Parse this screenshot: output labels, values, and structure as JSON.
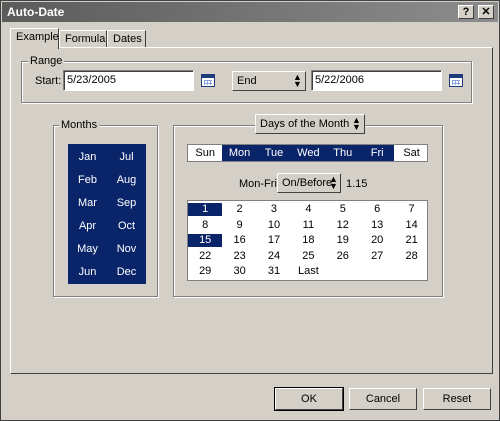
{
  "window": {
    "title": "Auto-Date",
    "help_button": "?",
    "close_button": "✕"
  },
  "tabs": [
    {
      "label": "Example",
      "active": true
    },
    {
      "label": "Formula",
      "active": false
    },
    {
      "label": "Dates",
      "active": false
    }
  ],
  "range": {
    "group_label": "Range",
    "start_label": "Start:",
    "start_value": "5/23/2005",
    "mode_select": "End",
    "end_value": "5/22/2006"
  },
  "months": {
    "group_label": "Months",
    "items": [
      "Jan",
      "Jul",
      "Feb",
      "Aug",
      "Mar",
      "Sep",
      "Apr",
      "Oct",
      "May",
      "Nov",
      "Jun",
      "Dec"
    ]
  },
  "days": {
    "mode_select": "Days of the Month",
    "weekdays": [
      {
        "label": "Sun",
        "selected": false
      },
      {
        "label": "Mon",
        "selected": true
      },
      {
        "label": "Tue",
        "selected": true
      },
      {
        "label": "Wed",
        "selected": true
      },
      {
        "label": "Thu",
        "selected": true
      },
      {
        "label": "Fri",
        "selected": true
      },
      {
        "label": "Sat",
        "selected": false
      }
    ],
    "monfri_label": "Mon-Fri",
    "monfri_select": "On/Before",
    "monfri_value": "1.15",
    "dates": [
      {
        "label": "1",
        "selected": true
      },
      {
        "label": "2",
        "selected": false
      },
      {
        "label": "3",
        "selected": false
      },
      {
        "label": "4",
        "selected": false
      },
      {
        "label": "5",
        "selected": false
      },
      {
        "label": "6",
        "selected": false
      },
      {
        "label": "7",
        "selected": false
      },
      {
        "label": "8",
        "selected": false
      },
      {
        "label": "9",
        "selected": false
      },
      {
        "label": "10",
        "selected": false
      },
      {
        "label": "11",
        "selected": false
      },
      {
        "label": "12",
        "selected": false
      },
      {
        "label": "13",
        "selected": false
      },
      {
        "label": "14",
        "selected": false
      },
      {
        "label": "15",
        "selected": true
      },
      {
        "label": "16",
        "selected": false
      },
      {
        "label": "17",
        "selected": false
      },
      {
        "label": "18",
        "selected": false
      },
      {
        "label": "19",
        "selected": false
      },
      {
        "label": "20",
        "selected": false
      },
      {
        "label": "21",
        "selected": false
      },
      {
        "label": "22",
        "selected": false
      },
      {
        "label": "23",
        "selected": false
      },
      {
        "label": "24",
        "selected": false
      },
      {
        "label": "25",
        "selected": false
      },
      {
        "label": "26",
        "selected": false
      },
      {
        "label": "27",
        "selected": false
      },
      {
        "label": "28",
        "selected": false
      },
      {
        "label": "29",
        "selected": false
      },
      {
        "label": "30",
        "selected": false
      },
      {
        "label": "31",
        "selected": false
      },
      {
        "label": "Last",
        "selected": false
      }
    ]
  },
  "buttons": {
    "ok": "OK",
    "cancel": "Cancel",
    "reset": "Reset"
  },
  "colors": {
    "selection": "#0a246a",
    "window_bg": "#d4d0c8"
  }
}
